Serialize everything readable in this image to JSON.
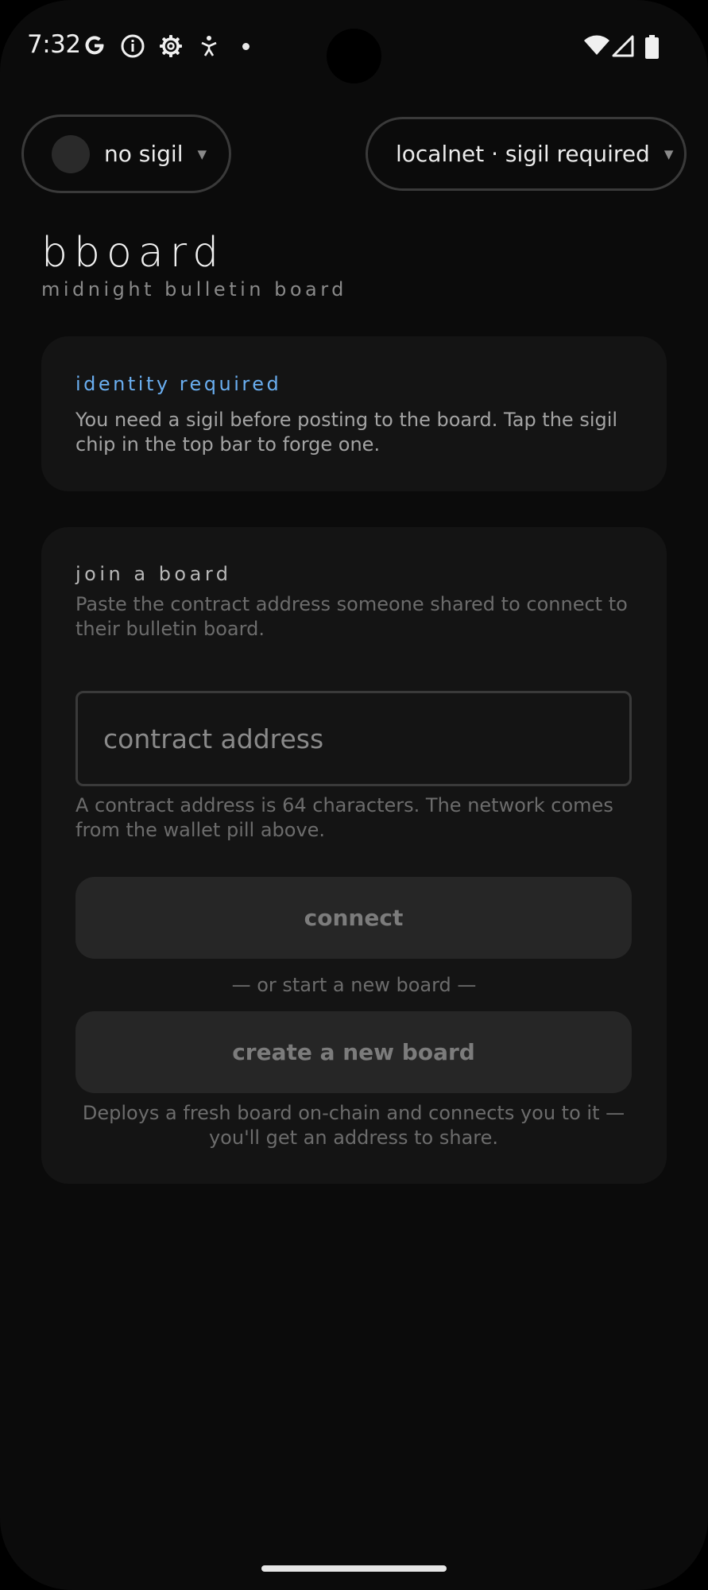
{
  "status_bar": {
    "time": "7:32",
    "icons": [
      "google-icon",
      "info-icon",
      "settings-icon",
      "accessibility-icon",
      "dot-icon",
      "wifi-icon",
      "signal-icon",
      "battery-icon"
    ]
  },
  "top_bar": {
    "sigil_chip": {
      "label": "no sigil"
    },
    "network_chip": {
      "label": "localnet · sigil required"
    }
  },
  "header": {
    "title": "bboard",
    "subtitle": "midnight bulletin board"
  },
  "identity_card": {
    "title": "identity required",
    "body": "You need a sigil before posting to the board. Tap the sigil chip in the top bar to forge one."
  },
  "join_card": {
    "title": "join a board",
    "description": "Paste the contract address someone shared to connect to their bulletin board.",
    "address_input": {
      "placeholder": "contract address",
      "value": ""
    },
    "input_help": "A contract address is 64 characters. The network comes from the wallet pill above.",
    "connect_label": "connect",
    "divider": "— or start a new board —",
    "create_label": "create a new board",
    "create_help": "Deploys a fresh board on-chain and connects you to it — you'll get an address to share."
  },
  "colors": {
    "background": "#0b0b0b",
    "card": "#141414",
    "accent": "#6aaef0",
    "button": "#262626"
  }
}
